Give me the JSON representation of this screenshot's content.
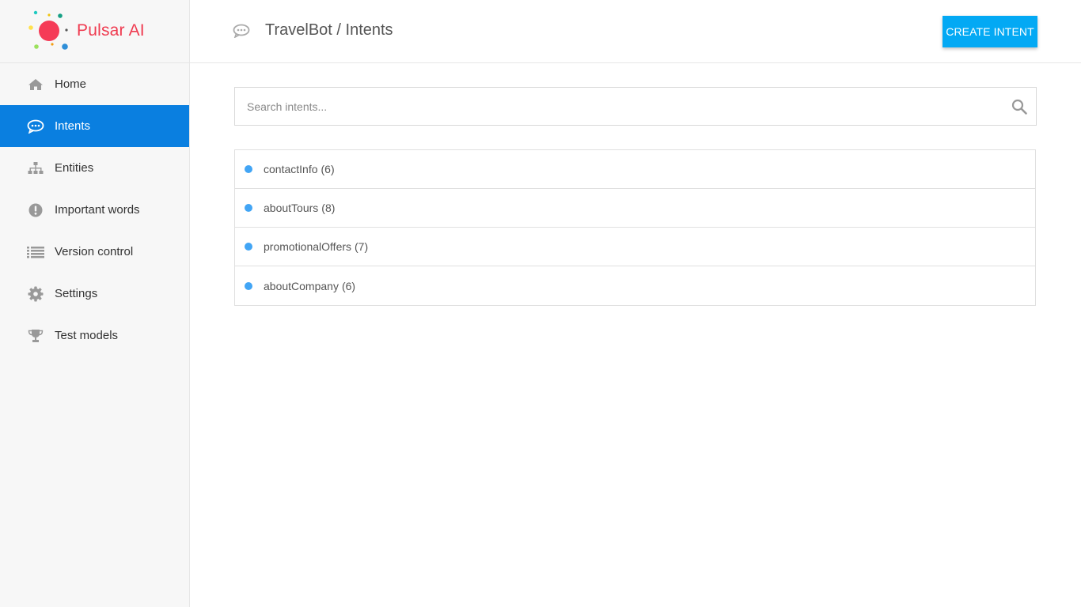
{
  "brand": {
    "name": "Pulsar AI",
    "color": "#ef3b50"
  },
  "sidebar": {
    "items": [
      {
        "label": "Home",
        "icon": "home-icon",
        "active": false
      },
      {
        "label": "Intents",
        "icon": "chat-icon",
        "active": true
      },
      {
        "label": "Entities",
        "icon": "sitemap-icon",
        "active": false
      },
      {
        "label": "Important words",
        "icon": "exclamation-icon",
        "active": false
      },
      {
        "label": "Version control",
        "icon": "list-icon",
        "active": false
      },
      {
        "label": "Settings",
        "icon": "gear-icon",
        "active": false
      },
      {
        "label": "Test models",
        "icon": "trophy-icon",
        "active": false
      }
    ],
    "active_color": "#0a7fe0"
  },
  "header": {
    "icon": "chat-icon",
    "title": "TravelBot / Intents",
    "create_button_label": "CREATE INTENT",
    "button_color": "#03a9f4"
  },
  "search": {
    "placeholder": "Search intents...",
    "value": "",
    "icon": "search-icon"
  },
  "intents": [
    {
      "name": "contactInfo",
      "count": "(6)"
    },
    {
      "name": "aboutTours",
      "count": "(8)"
    },
    {
      "name": "promotionalOffers",
      "count": "(7)"
    },
    {
      "name": "aboutCompany",
      "count": "(6)"
    }
  ]
}
